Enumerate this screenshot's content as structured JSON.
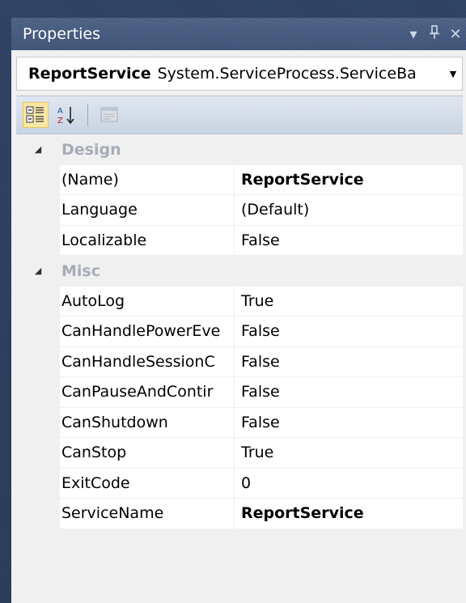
{
  "window": {
    "title": "Properties",
    "buttons": [
      {
        "name": "dropdown-arrow-icon",
        "glyph": "▾"
      },
      {
        "name": "pin-icon",
        "glyph": "ꟼ"
      },
      {
        "name": "close-icon",
        "glyph": "✕"
      }
    ]
  },
  "selector": {
    "object_name": "ReportService",
    "object_type": "System.ServiceProcess.ServiceBa",
    "dropdown_glyph": "▼"
  },
  "toolbar": {
    "categorized_icon": "categorized-icon",
    "alphabetical_icon": "alphabetical-icon",
    "property_pages_icon": "property-pages-icon"
  },
  "grid": {
    "categories": [
      {
        "label": "Design",
        "expand_glyph": "◢",
        "properties": [
          {
            "name": "(Name)",
            "value": "ReportService",
            "bold": true
          },
          {
            "name": "Language",
            "value": "(Default)",
            "bold": false
          },
          {
            "name": "Localizable",
            "value": "False",
            "bold": false
          }
        ]
      },
      {
        "label": "Misc",
        "expand_glyph": "◢",
        "properties": [
          {
            "name": "AutoLog",
            "value": "True",
            "bold": false
          },
          {
            "name": "CanHandlePowerEve",
            "value": "False",
            "bold": false
          },
          {
            "name": "CanHandleSessionC",
            "value": "False",
            "bold": false
          },
          {
            "name": "CanPauseAndContir",
            "value": "False",
            "bold": false
          },
          {
            "name": "CanShutdown",
            "value": "False",
            "bold": false
          },
          {
            "name": "CanStop",
            "value": "True",
            "bold": false
          },
          {
            "name": "ExitCode",
            "value": "0",
            "bold": false
          },
          {
            "name": "ServiceName",
            "value": "ReportService",
            "bold": true
          }
        ]
      }
    ]
  },
  "colors": {
    "titlebar": "#46597d",
    "panel": "#f0f0f0",
    "category_text": "#a6acb8",
    "tool_active": "#fbe8a4"
  }
}
